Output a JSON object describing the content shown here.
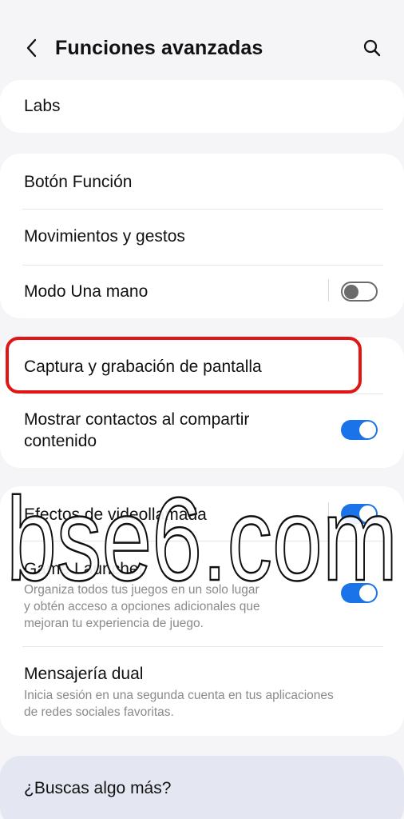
{
  "header": {
    "title": "Funciones avanzadas",
    "back_icon": "chevron-left-icon",
    "search_icon": "search-icon"
  },
  "sections": [
    {
      "items": [
        {
          "label": "Labs"
        }
      ]
    },
    {
      "items": [
        {
          "label": "Botón Función"
        },
        {
          "label": "Movimientos y gestos"
        },
        {
          "label": "Modo Una mano",
          "toggle": false
        }
      ]
    },
    {
      "items": [
        {
          "label": "Captura y grabación de pantalla",
          "highlighted": true
        },
        {
          "label_line1": "Mostrar contactos al compartir",
          "label_line2": "contenido",
          "toggle": true
        }
      ]
    },
    {
      "items": [
        {
          "label": "Efectos de videollamada",
          "toggle": true
        },
        {
          "label": "Game Launcher",
          "desc_line1": "Organiza todos tus juegos en un solo lugar",
          "desc_line2": "y obtén acceso a opciones adicionales que",
          "desc_line3": "mejoran tu experiencia de juego.",
          "toggle": true
        },
        {
          "label": "Mensajería dual",
          "desc_line1": "Inicia sesión en una segunda cuenta en tus aplicaciones",
          "desc_line2": "de redes sociales favoritas."
        }
      ]
    }
  ],
  "footer": {
    "label": "¿Buscas algo más?"
  },
  "watermark": {
    "text": "bse6.com"
  },
  "colors": {
    "accent": "#1a73e8",
    "highlight": "#e01616",
    "background": "#f5f5f7"
  }
}
